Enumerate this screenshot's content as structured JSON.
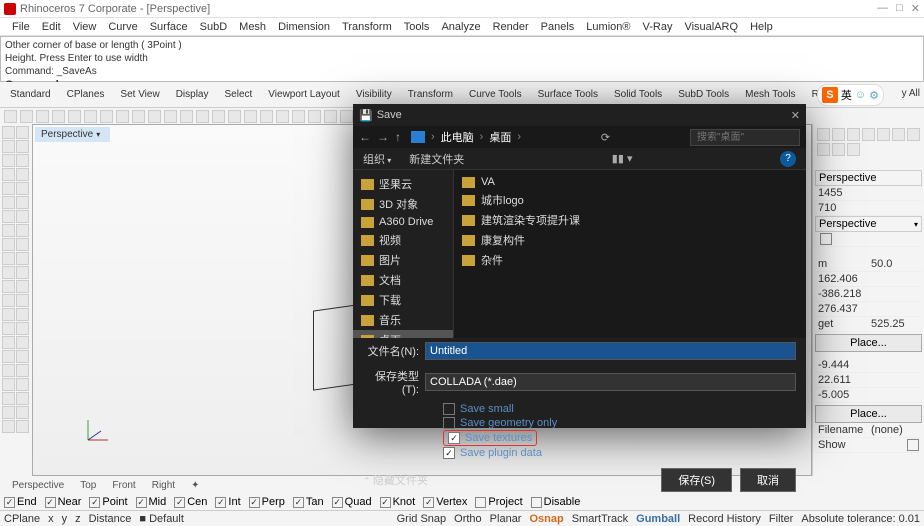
{
  "title": "Rhinoceros 7 Corporate - [Perspective]",
  "menus": [
    "File",
    "Edit",
    "View",
    "Curve",
    "Surface",
    "SubD",
    "Mesh",
    "Dimension",
    "Transform",
    "Tools",
    "Analyze",
    "Render",
    "Panels",
    "Lumion®",
    "V-Ray",
    "VisualARQ",
    "Help"
  ],
  "cmd": {
    "l1": "Other corner of base or length ( 3Point )",
    "l2": "Height. Press Enter to use width",
    "l3": "Command: _SaveAs",
    "l4": "Command:"
  },
  "tabs": [
    "Standard",
    "CPlanes",
    "Set View",
    "Display",
    "Select",
    "Viewport Layout",
    "Visibility",
    "Transform",
    "Curve Tools",
    "Surface Tools",
    "Solid Tools",
    "SubD Tools",
    "Mesh Tools",
    "Render Tools"
  ],
  "pill": {
    "s": "S",
    "zh": "英"
  },
  "vall": "y All",
  "viewport_tab": "Perspective",
  "info": {
    "head": "Perspective",
    "r1": "1455",
    "r2": "710",
    "sel": "Perspective",
    "m": "m",
    "v1": "50.0",
    "v2": "162.406",
    "v3": "-386.218",
    "v4": "276.437",
    "tgt": "get",
    "tgtv": "525.25",
    "place": "Place...",
    "w1": "-9.444",
    "w2": "22.611",
    "w3": "-5.005",
    "file": "Filename",
    "filev": "(none)",
    "show": "Show"
  },
  "vtabs": [
    "Perspective",
    "Top",
    "Front",
    "Right"
  ],
  "osnap": [
    "End",
    "Near",
    "Point",
    "Mid",
    "Cen",
    "Int",
    "Perp",
    "Tan",
    "Quad",
    "Knot",
    "Vertex",
    "Project",
    "Disable"
  ],
  "status": {
    "cplane": "CPlane",
    "x": "x",
    "y": "y",
    "z": "z",
    "dist": "Distance",
    "def": "■ Default",
    "items": [
      "Grid Snap",
      "Ortho",
      "Planar",
      "Osnap",
      "SmartTrack",
      "Gumball",
      "Record History",
      "Filter"
    ],
    "tol": "Absolute tolerance: 0.01"
  },
  "dialog": {
    "title": "Save",
    "crumb": [
      "此电脑",
      "桌面"
    ],
    "search_ph": "搜索\"桌面\"",
    "org": "组织",
    "newf": "新建文件夹",
    "tree": [
      "坚果云",
      "3D 对象",
      "A360 Drive",
      "视频",
      "图片",
      "文档",
      "下载",
      "音乐",
      "桌面"
    ],
    "files": [
      "VA",
      "城市logo",
      "建筑渲染专项提升课",
      "康复构件",
      "杂件"
    ],
    "fname_lbl": "文件名(N):",
    "fname": "Untitled",
    "ftype_lbl": "保存类型(T):",
    "ftype": "COLLADA (*.dae)",
    "opts": [
      "Save small",
      "Save geometry only",
      "Save textures",
      "Save plugin data"
    ],
    "hide": "隐藏文件夹",
    "save": "保存(S)",
    "cancel": "取消"
  },
  "chart_data": null
}
